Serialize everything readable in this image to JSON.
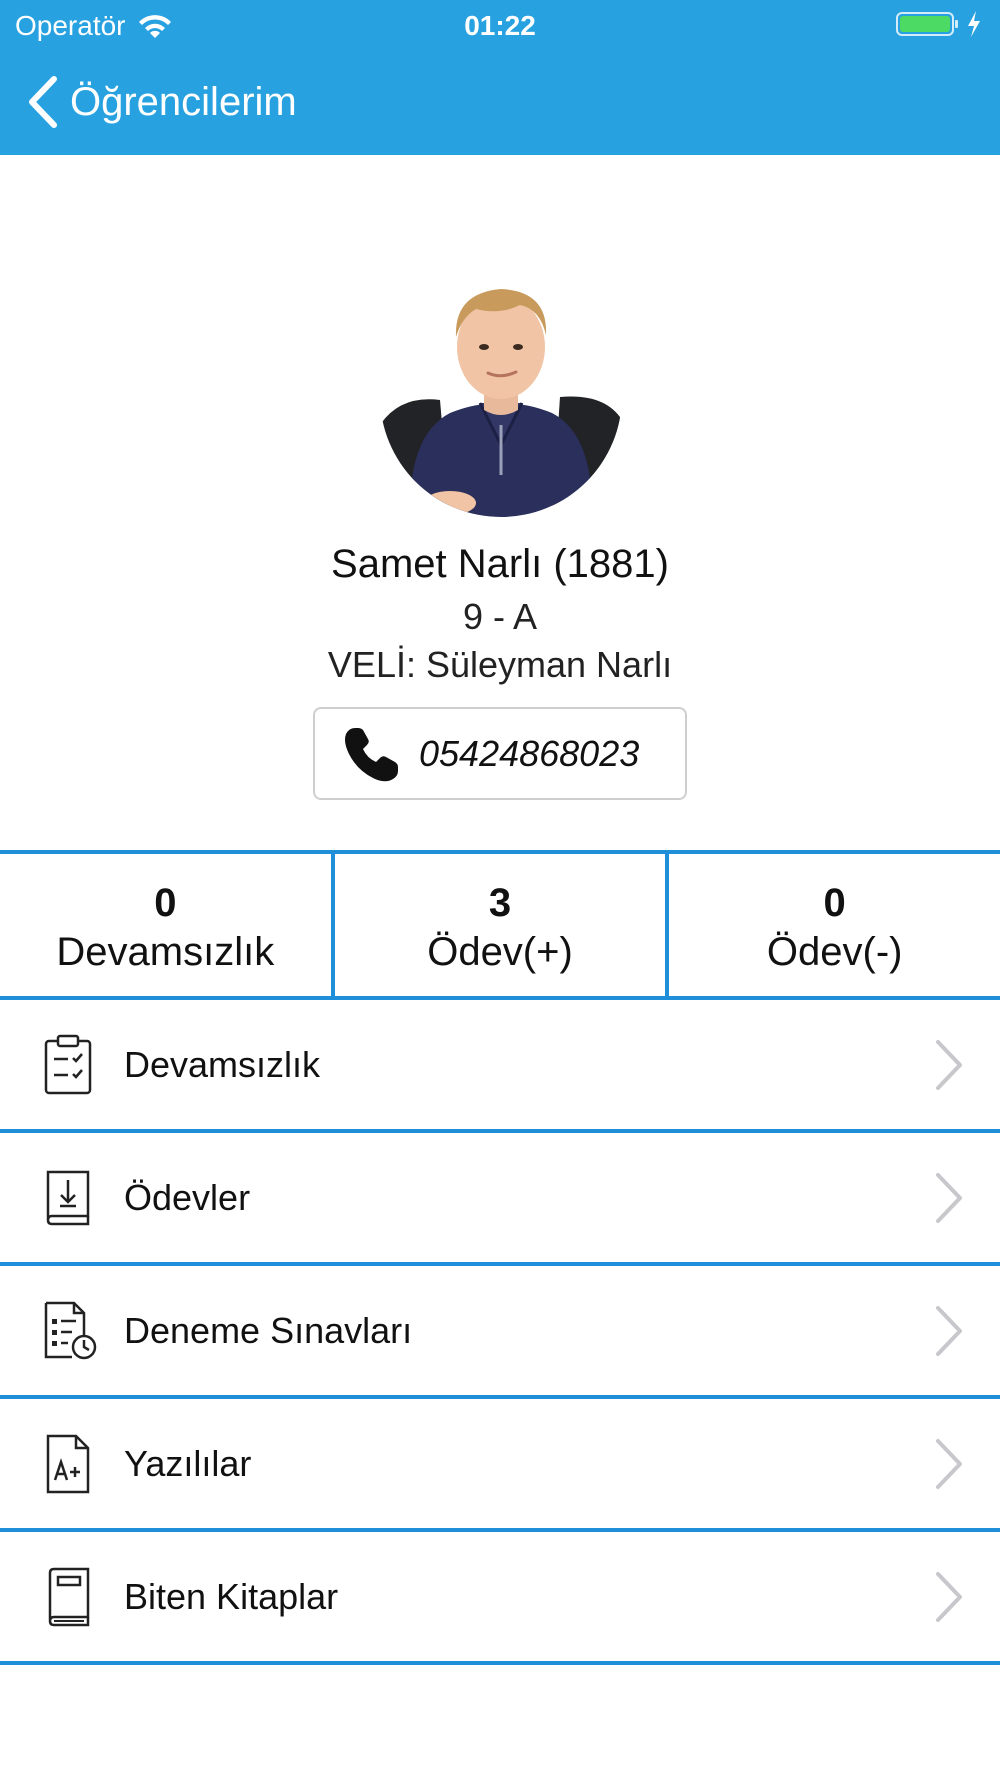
{
  "status_bar": {
    "carrier": "Operatör",
    "time": "01:22"
  },
  "nav": {
    "back_label": "Öğrencilerim"
  },
  "student": {
    "name": "Samet Narlı (1881)",
    "class": "9 - A",
    "parent": "VELİ: Süleyman Narlı",
    "phone": "05424868023"
  },
  "stats": [
    {
      "value": "0",
      "label": "Devamsızlık"
    },
    {
      "value": "3",
      "label": "Ödev(+)"
    },
    {
      "value": "0",
      "label": "Ödev(-)"
    }
  ],
  "menu": [
    {
      "label": "Devamsızlık",
      "icon": "attendance-clipboard-icon"
    },
    {
      "label": "Ödevler",
      "icon": "homework-book-icon"
    },
    {
      "label": "Deneme Sınavları",
      "icon": "exam-document-icon"
    },
    {
      "label": "Yazılılar",
      "icon": "grade-document-icon"
    },
    {
      "label": "Biten Kitaplar",
      "icon": "book-icon"
    }
  ],
  "colors": {
    "header": "#27a1e0",
    "divider": "#1e8fd8",
    "battery": "#4cd964"
  }
}
